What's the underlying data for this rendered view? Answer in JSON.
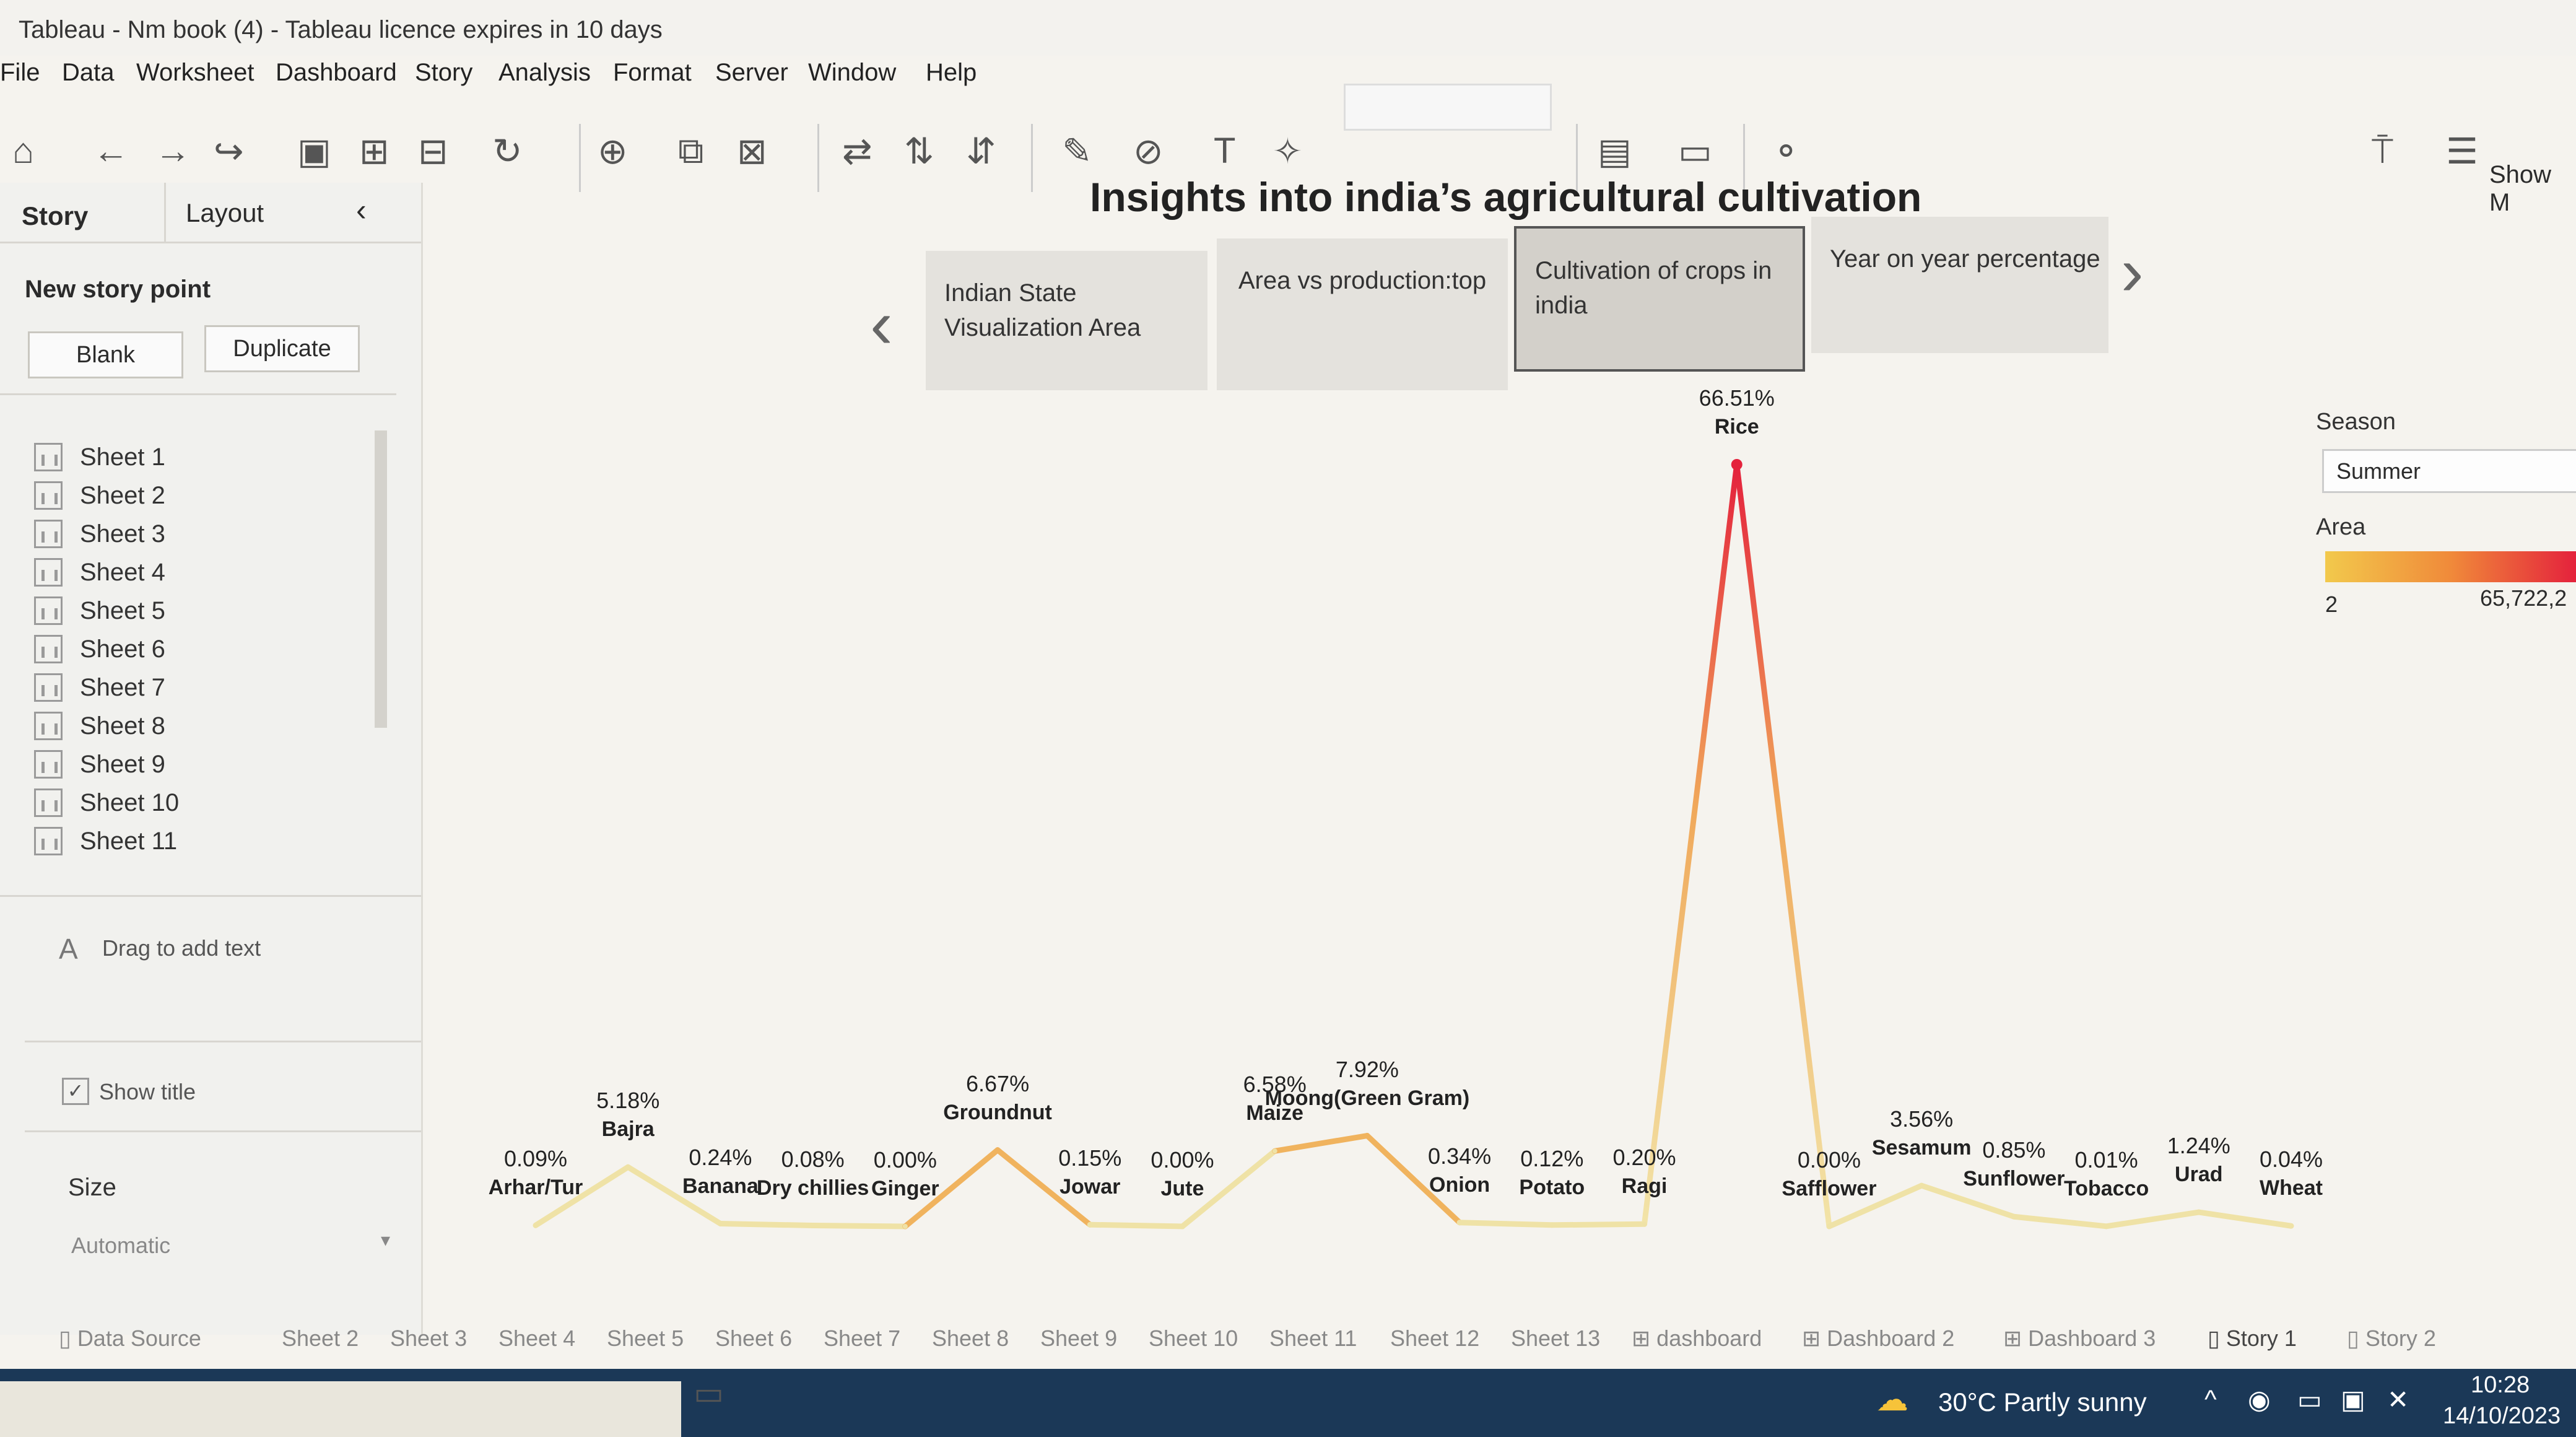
{
  "window": {
    "title": "Tableau - Nm book (4) - Tableau licence expires in 10 days"
  },
  "menu": [
    "File",
    "Data",
    "Worksheet",
    "Dashboard",
    "Story",
    "Analysis",
    "Format",
    "Server",
    "Window",
    "Help"
  ],
  "toolbar_right": {
    "show_me": "Show M"
  },
  "left_panel": {
    "tab_story": "Story",
    "tab_layout": "Layout",
    "new_story_point": "New story point",
    "blank": "Blank",
    "duplicate": "Duplicate",
    "sheets": [
      "Sheet 1",
      "Sheet 2",
      "Sheet 3",
      "Sheet 4",
      "Sheet 5",
      "Sheet 6",
      "Sheet 7",
      "Sheet 8",
      "Sheet 9",
      "Sheet 10",
      "Sheet 11"
    ],
    "drag_text": "Drag to add text",
    "show_title": "Show title",
    "size_label": "Size",
    "size_value": "Automatic"
  },
  "story": {
    "title": "Insights into india’s agricultural cultivation",
    "points": [
      "Indian State Visualization Area",
      "Area vs production:top",
      "Cultivation of crops in india",
      "Year on year percentage"
    ],
    "active_point": 2
  },
  "legend": {
    "season_label": "Season",
    "season_value": "Summer",
    "area_label": "Area",
    "area_min": "2",
    "area_max": "65,722,2"
  },
  "chart_data": {
    "type": "line",
    "categories": [
      "Arhar/Tur",
      "Bajra",
      "Banana",
      "Dry chillies",
      "Ginger",
      "Groundnut",
      "Jowar",
      "Jute",
      "Maize",
      "Moong(Green Gram)",
      "Onion",
      "Potato",
      "Ragi",
      "Rice",
      "Safflower",
      "Sesamum",
      "Sunflower",
      "Tobacco",
      "Urad",
      "Wheat"
    ],
    "values": [
      0.09,
      5.18,
      0.24,
      0.08,
      0.0,
      6.67,
      0.15,
      0.0,
      6.58,
      7.92,
      0.34,
      0.12,
      0.2,
      66.51,
      0.0,
      3.56,
      0.85,
      0.01,
      1.24,
      0.04
    ],
    "labels": [
      "0.09%",
      "5.18%",
      "0.24%",
      "0.08%",
      "0.00%",
      "6.67%",
      "0.15%",
      "0.00%",
      "6.58%",
      "7.92%",
      "0.34%",
      "0.12%",
      "0.20%",
      "66.51%",
      "0.00%",
      "3.56%",
      "0.85%",
      "0.01%",
      "1.24%",
      "0.04%"
    ]
  },
  "bottom_tabs": [
    "Data Source",
    "Sheet 2",
    "Sheet 3",
    "Sheet 4",
    "Sheet 5",
    "Sheet 6",
    "Sheet 7",
    "Sheet 8",
    "Sheet 9",
    "Sheet 10",
    "Sheet 11",
    "Sheet 12",
    "Sheet 13",
    "dashboard",
    "Dashboard 2",
    "Dashboard 3",
    "Story 1",
    "Story 2"
  ],
  "taskbar": {
    "weather": "30°C  Partly sunny",
    "time": "10:28",
    "date": "14/10/2023"
  },
  "colors": {
    "line_low": "#f2e3a6",
    "line_high": "#e8243c",
    "taskbar": "#1b3857"
  }
}
